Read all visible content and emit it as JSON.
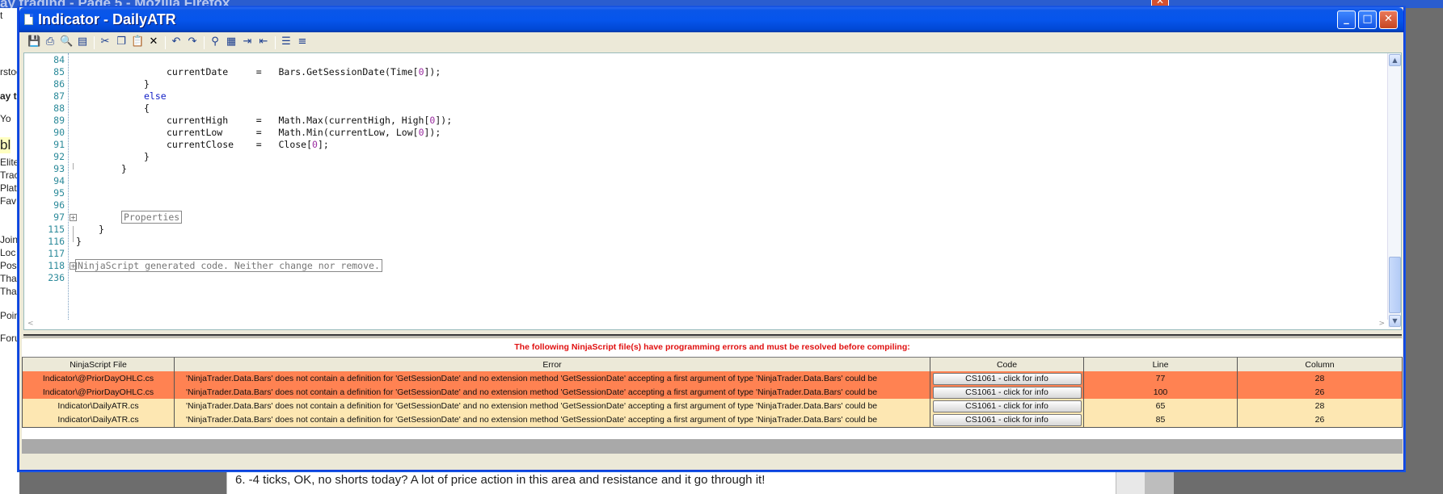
{
  "background": {
    "browser_title": "ay trading - Page 5 - Mozilla Firefox",
    "left_fragments": [
      "t",
      "rstoc",
      "ay t",
      "Yo",
      "bl",
      "Elite",
      "Trac",
      "Plat",
      "Fav",
      "Join",
      "Loc",
      "Pos",
      "Tha",
      "Tha",
      "Poin",
      "Foru"
    ],
    "page_text": "6. -4 ticks, OK, no shorts today? A lot of price action in this area and resistance and it go through it!"
  },
  "window": {
    "title": "Indicator - DailyATR",
    "min_label": "_",
    "max_label": "□",
    "close_label": "✕"
  },
  "toolbar": {
    "icons": [
      "save-icon",
      "print-icon",
      "print-preview-icon",
      "page-setup-icon",
      "cut-icon",
      "copy-icon",
      "paste-icon",
      "delete-icon",
      "undo-icon",
      "redo-icon",
      "find-icon",
      "replace-icon",
      "indent-icon",
      "outdent-icon",
      "comment-icon",
      "uncomment-icon"
    ]
  },
  "editor": {
    "lines": [
      {
        "num": "84",
        "text": ""
      },
      {
        "num": "85",
        "text": "currentDate     =   Bars.GetSessionDate(Time[0]);"
      },
      {
        "num": "86",
        "text": "}"
      },
      {
        "num": "87",
        "text": "else"
      },
      {
        "num": "88",
        "text": "{"
      },
      {
        "num": "89",
        "text": "currentHigh     =   Math.Max(currentHigh, High[0]);"
      },
      {
        "num": "90",
        "text": "currentLow      =   Math.Min(currentLow, Low[0]);"
      },
      {
        "num": "91",
        "text": "currentClose    =   Close[0];"
      },
      {
        "num": "92",
        "text": "}"
      },
      {
        "num": "93",
        "text": "}"
      },
      {
        "num": "94",
        "text": ""
      },
      {
        "num": "95",
        "text": ""
      },
      {
        "num": "96",
        "text": ""
      },
      {
        "num": "97",
        "text": "Properties"
      },
      {
        "num": "115",
        "text": "}"
      },
      {
        "num": "116",
        "text": "}"
      },
      {
        "num": "117",
        "text": ""
      },
      {
        "num": "118",
        "text": "NinjaScript generated code. Neither change nor remove."
      },
      {
        "num": "236",
        "text": ""
      }
    ]
  },
  "errors": {
    "heading": "The following NinjaScript file(s) have programming errors and must be resolved before compiling:",
    "columns": [
      "NinjaScript File",
      "Error",
      "Code",
      "Line",
      "Column"
    ],
    "rows": [
      {
        "file": "Indicator\\@PriorDayOHLC.cs",
        "error": "'NinjaTrader.Data.Bars' does not contain a definition for 'GetSessionDate' and no extension method 'GetSessionDate' accepting a first argument of type 'NinjaTrader.Data.Bars' could be",
        "code": "CS1061 - click for info",
        "line": "77",
        "column": "28",
        "severity": "error"
      },
      {
        "file": "Indicator\\@PriorDayOHLC.cs",
        "error": "'NinjaTrader.Data.Bars' does not contain a definition for 'GetSessionDate' and no extension method 'GetSessionDate' accepting a first argument of type 'NinjaTrader.Data.Bars' could be",
        "code": "CS1061 - click for info",
        "line": "100",
        "column": "26",
        "severity": "error"
      },
      {
        "file": "Indicator\\DailyATR.cs",
        "error": "'NinjaTrader.Data.Bars' does not contain a definition for 'GetSessionDate' and no extension method 'GetSessionDate' accepting a first argument of type 'NinjaTrader.Data.Bars' could be",
        "code": "CS1061 - click for info",
        "line": "65",
        "column": "28",
        "severity": "warn"
      },
      {
        "file": "Indicator\\DailyATR.cs",
        "error": "'NinjaTrader.Data.Bars' does not contain a definition for 'GetSessionDate' and no extension method 'GetSessionDate' accepting a first argument of type 'NinjaTrader.Data.Bars' could be",
        "code": "CS1061 - click for info",
        "line": "85",
        "column": "26",
        "severity": "warn"
      }
    ]
  },
  "colors": {
    "error_row": "#ff8252",
    "warn_row": "#fde7b2",
    "heading_red": "#e01010",
    "titlebar_blue": "#0655ec"
  }
}
